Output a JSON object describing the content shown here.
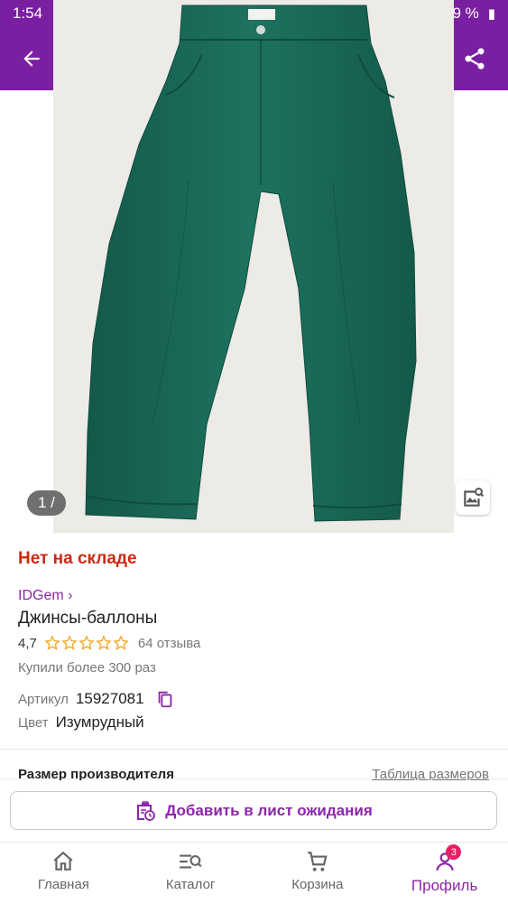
{
  "status_bar": {
    "time": "1:54",
    "battery": "69 %"
  },
  "gallery": {
    "counter": "1 /"
  },
  "product": {
    "stock_status": "Нет на складе",
    "brand": "IDGem ›",
    "title": "Джинсы-баллоны",
    "rating": "4,7",
    "stars": 4.7,
    "reviews": "64 отзыва",
    "purchases": "Купили более 300 раз",
    "article_label": "Артикул",
    "article_value": "15927081",
    "color_label": "Цвет",
    "color_value": "Изумрудный",
    "jeans_color": "#1b6b55"
  },
  "size": {
    "label": "Размер производителя",
    "table_link": "Таблица размеров"
  },
  "action": {
    "waitlist_label": "Добавить в лист ожидания"
  },
  "nav": {
    "items": [
      {
        "label": "Главная",
        "icon": "home-icon"
      },
      {
        "label": "Каталог",
        "icon": "catalog-search-icon"
      },
      {
        "label": "Корзина",
        "icon": "cart-icon"
      },
      {
        "label": "Профиль",
        "icon": "profile-icon",
        "badge": "3"
      }
    ]
  },
  "colors": {
    "accent": "#7b1fa2",
    "brand_text": "#8e24aa",
    "out_of_stock": "#cc2a12",
    "star": "#f6a623"
  }
}
